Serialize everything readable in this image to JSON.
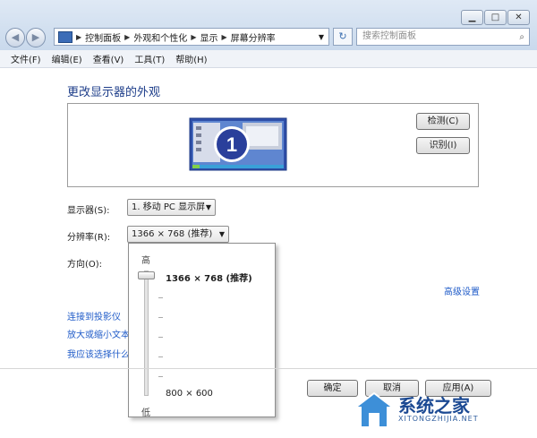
{
  "nav": {
    "breadcrumb": [
      "控制面板",
      "外观和个性化",
      "显示",
      "屏幕分辨率"
    ],
    "search_placeholder": "搜索控制面板"
  },
  "menu": [
    "文件(F)",
    "编辑(E)",
    "查看(V)",
    "工具(T)",
    "帮助(H)"
  ],
  "heading": "更改显示器的外观",
  "monitor_number": "1",
  "buttons": {
    "detect": "检测(C)",
    "identify": "识别(I)",
    "ok": "确定",
    "cancel": "取消",
    "apply": "应用(A)"
  },
  "fields": {
    "display_label": "显示器(S):",
    "display_value": "1. 移动 PC 显示屏",
    "resolution_label": "分辨率(R):",
    "resolution_value": "1366 × 768 (推荐)",
    "orientation_label": "方向(O):"
  },
  "links": {
    "advanced": "高级设置",
    "projector": "连接到投影仪",
    "text_size": "放大或缩小文本",
    "which": "我应该选择什么"
  },
  "slider": {
    "high": "高",
    "low": "低",
    "top_value": "1366 × 768 (推荐)",
    "bottom_value": "800 × 600",
    "selected_level": 1.0
  },
  "watermark": {
    "brand": "系统之家",
    "site": "XITONGZHIJIA.NET"
  },
  "colors": {
    "link": "#1f5bc8",
    "heading": "#1e3e8a",
    "monitor_blue": "#2f4fa8"
  }
}
